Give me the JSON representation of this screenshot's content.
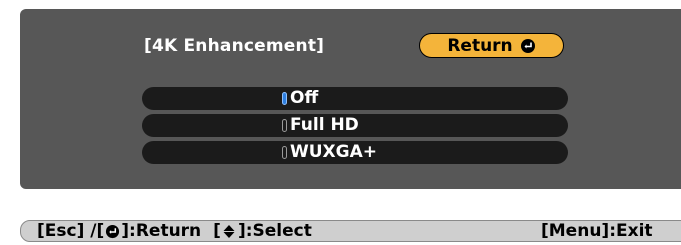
{
  "menu": {
    "title": "[4K Enhancement]",
    "return_label": "Return",
    "return_icon": "enter-icon",
    "options": [
      {
        "label": "Off",
        "selected": true
      },
      {
        "label": "Full HD",
        "selected": false
      },
      {
        "label": "WUXGA+",
        "selected": false
      }
    ]
  },
  "status_bar": {
    "esc_prefix": "[Esc] /[",
    "esc_suffix": "]:Return",
    "select_prefix": "[",
    "select_suffix": "]:Select",
    "menu_exit": "[Menu]:Exit",
    "icons": [
      "enter-icon",
      "up-down-arrow-icon"
    ]
  },
  "colors": {
    "panel_bg": "#575757",
    "option_bg": "#1b1b1b",
    "accent": "#f4b43a",
    "selected_radio": "#2e7fe0",
    "status_bar_bg": "#cfcfcf"
  }
}
